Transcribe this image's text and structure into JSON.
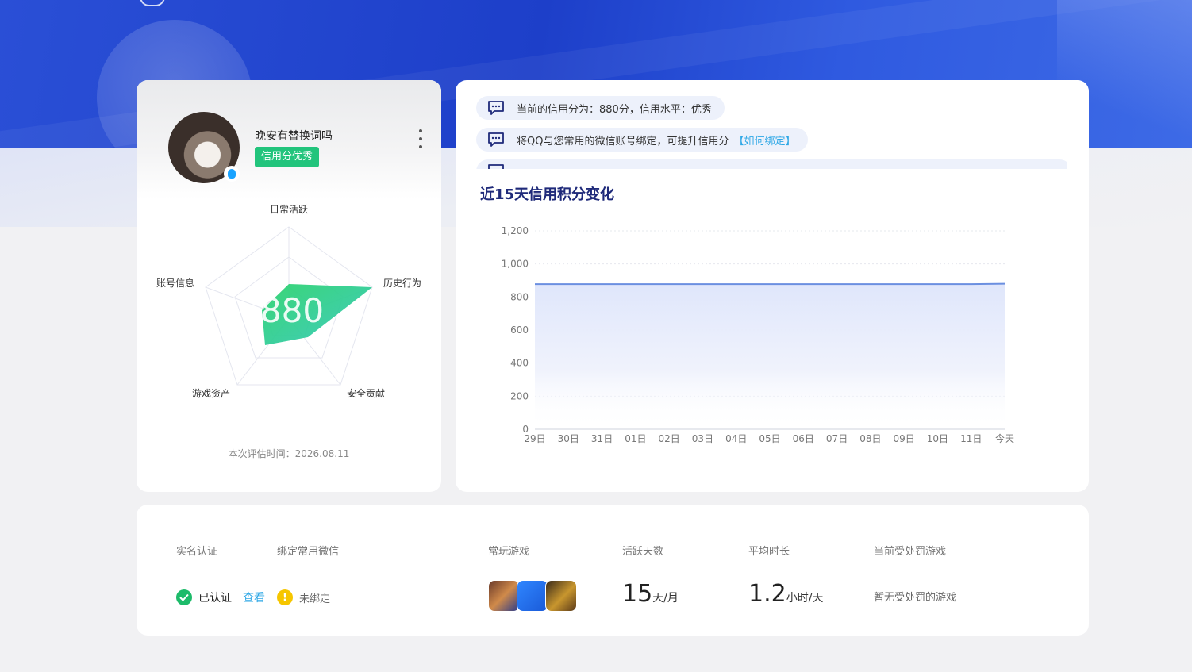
{
  "profile": {
    "username": "晚安有替换词吗",
    "credit_tag": "信用分优秀",
    "score": "880",
    "eval_time": "本次评估时间：2026.08.11"
  },
  "radar": {
    "labels": {
      "daily": "日常活跃",
      "history": "历史行为",
      "security": "安全贡献",
      "assets": "游戏资产",
      "account": "账号信息"
    }
  },
  "notices": [
    {
      "text": "当前的信用分为：880分，信用水平：优秀",
      "link": ""
    },
    {
      "text": "将QQ与您常用的微信账号绑定，可提升信用分",
      "link": "【如何绑定】"
    }
  ],
  "chart_data": {
    "type": "area",
    "title": "近15天信用积分变化",
    "categories": [
      "29日",
      "30日",
      "31日",
      "01日",
      "02日",
      "03日",
      "04日",
      "05日",
      "06日",
      "07日",
      "08日",
      "09日",
      "10日",
      "11日",
      "今天"
    ],
    "series": [
      {
        "values": [
          878,
          878,
          878,
          878,
          878,
          878,
          878,
          878,
          878,
          878,
          878,
          878,
          878,
          878,
          880
        ]
      }
    ],
    "y_ticks": [
      "0",
      "200",
      "400",
      "600",
      "800",
      "1,000",
      "1,200"
    ],
    "ylim": [
      0,
      1200
    ],
    "grid": true,
    "colors": {
      "line": "#6b8fe0",
      "fill_top": "#dfe6fb"
    }
  },
  "bottom": {
    "realname_label": "实名认证",
    "wechat_label": "绑定常用微信",
    "realname_status": "已认证",
    "view_link": "查看",
    "wechat_status": "未绑定",
    "games_label": "常玩游戏",
    "active_days_label": "活跃天数",
    "active_days_value": "15",
    "active_days_unit": "天/月",
    "avg_time_label": "平均时长",
    "avg_time_value": "1.2",
    "avg_time_unit": "小时/天",
    "punish_label": "当前受处罚游戏",
    "punish_value": "暂无受处罚的游戏"
  },
  "colors": {
    "brand_blue": "#1d3fc9",
    "success": "#1dbb6a",
    "warning": "#f6c600",
    "link": "#2fa8e6",
    "credit_tag": "#22c47c"
  }
}
